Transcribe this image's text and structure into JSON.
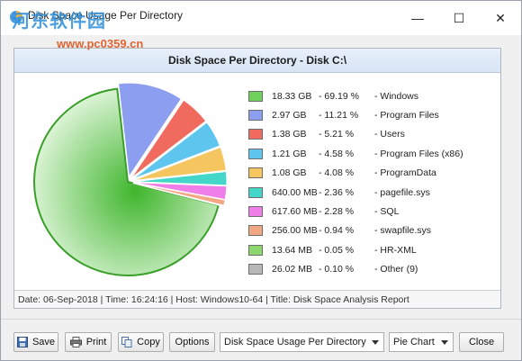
{
  "window": {
    "title": "Disk Space Usage Per Directory",
    "controls": {
      "minimize": "—",
      "maximize": "☐",
      "close": "✕"
    }
  },
  "watermark": {
    "logo_text": "河东软件园",
    "url": "www.pc0359.cn"
  },
  "panel": {
    "title": "Disk Space Per Directory - Disk C:\\",
    "status": "Date: 06-Sep-2018 | Time: 16:24:16 | Host: Windows10-64 | Title: Disk Space Analysis Report"
  },
  "chart_data": {
    "type": "pie",
    "title": "Disk Space Per Directory - Disk C:\\",
    "slices": [
      {
        "label": "Windows",
        "size": "18.33 GB",
        "percent": 69.19,
        "percent_text": "69.19 %",
        "color": "#6fd05a"
      },
      {
        "label": "Program Files",
        "size": "2.97 GB",
        "percent": 11.21,
        "percent_text": "11.21 %",
        "color": "#8c9ef0"
      },
      {
        "label": "Users",
        "size": "1.38 GB",
        "percent": 5.21,
        "percent_text": "5.21 %",
        "color": "#f06a5e"
      },
      {
        "label": "Program Files (x86)",
        "size": "1.21 GB",
        "percent": 4.58,
        "percent_text": "4.58 %",
        "color": "#5ec6ee"
      },
      {
        "label": "ProgramData",
        "size": "1.08 GB",
        "percent": 4.08,
        "percent_text": "4.08 %",
        "color": "#f5c560"
      },
      {
        "label": "pagefile.sys",
        "size": "640.00 MB",
        "percent": 2.36,
        "percent_text": "2.36 %",
        "color": "#44d6c8"
      },
      {
        "label": "SQL",
        "size": "617.60 MB",
        "percent": 2.28,
        "percent_text": "2.28 %",
        "color": "#f07ee8"
      },
      {
        "label": "swapfile.sys",
        "size": "256.00 MB",
        "percent": 0.94,
        "percent_text": "0.94 %",
        "color": "#f2a882"
      },
      {
        "label": "HR-XML",
        "size": "13.64 MB",
        "percent": 0.05,
        "percent_text": "0.05 %",
        "color": "#8cd86e"
      },
      {
        "label": "Other (9)",
        "size": "26.02 MB",
        "percent": 0.1,
        "percent_text": "0.10 %",
        "color": "#b8b8b8"
      }
    ],
    "legend_position": "right"
  },
  "toolbar": {
    "save_label": "Save",
    "print_label": "Print",
    "copy_label": "Copy",
    "options_label": "Options",
    "report_select": "Disk Space Usage Per Directory",
    "chart_type_select": "Pie Chart",
    "close_label": "Close"
  },
  "icons": {
    "save": "floppy-icon",
    "print": "printer-icon",
    "copy": "copy-icon"
  }
}
